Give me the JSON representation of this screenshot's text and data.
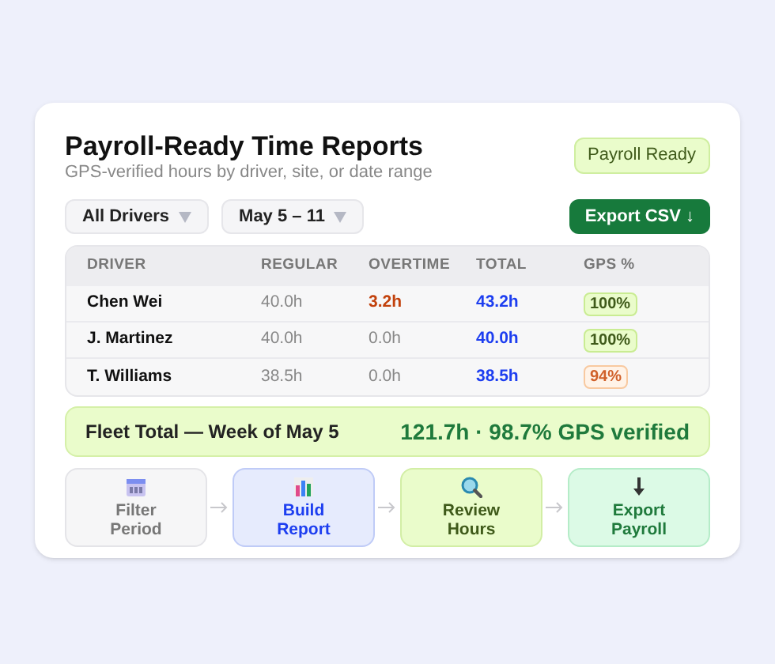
{
  "title": "Payroll-Ready Time Reports",
  "subtitle": "GPS-verified hours by driver, site, or date range",
  "status_badge": "Payroll Ready",
  "filters": [
    {
      "label": "All Drivers"
    },
    {
      "label": "May 5 – 11"
    }
  ],
  "export_button": "Export CSV ↓",
  "table": {
    "columns": [
      "DRIVER",
      "REGULAR",
      "OVERTIME",
      "TOTAL",
      "GPS %"
    ],
    "rows": [
      {
        "driver": "Chen Wei",
        "regular": "40.0h",
        "overtime": "3.2h",
        "overtime_flagged": true,
        "total": "43.2h",
        "gps": "100%",
        "gps_warning": false
      },
      {
        "driver": "J. Martinez",
        "regular": "40.0h",
        "overtime": "0.0h",
        "overtime_flagged": false,
        "total": "40.0h",
        "gps": "100%",
        "gps_warning": false
      },
      {
        "driver": "T. Williams",
        "regular": "38.5h",
        "overtime": "0.0h",
        "overtime_flagged": false,
        "total": "38.5h",
        "gps": "94%",
        "gps_warning": true
      }
    ]
  },
  "summary": {
    "label": "Fleet Total — Week of May 5",
    "value": "121.7h · 98.7% GPS verified"
  },
  "steps": [
    {
      "kind": "filter",
      "label": "Filter Period"
    },
    {
      "kind": "build",
      "label": "Build Report"
    },
    {
      "kind": "review",
      "label": "Review Hours"
    },
    {
      "kind": "export",
      "label": "Export Payroll"
    }
  ]
}
